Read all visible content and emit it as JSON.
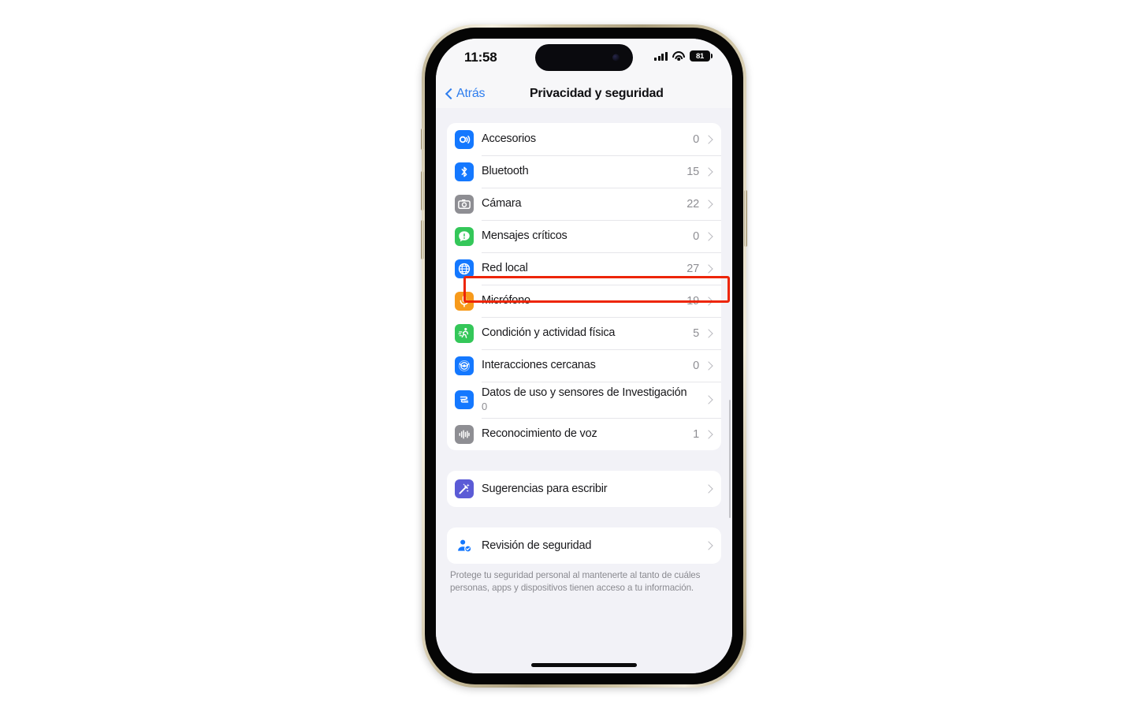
{
  "status_bar": {
    "time": "11:58",
    "cellular_icon": "cellular-bars-icon",
    "wifi_icon": "wifi-icon",
    "battery_level": "81"
  },
  "nav_bar": {
    "back_label": "Atrás",
    "title": "Privacidad y seguridad",
    "back_icon": "chevron-left-icon",
    "accent_color": "#2e7dee"
  },
  "highlight": {
    "color": "#ed2506",
    "target_row": "Red local"
  },
  "groups": [
    {
      "id": "permissions",
      "rows": [
        {
          "label": "Accesorios",
          "count": "0",
          "icon": "accessories-icon",
          "icon_color": "#1478ff"
        },
        {
          "label": "Bluetooth",
          "count": "15",
          "icon": "bluetooth-icon",
          "icon_color": "#1478ff"
        },
        {
          "label": "Cámara",
          "count": "22",
          "icon": "camera-icon",
          "icon_color": "#8e8e93"
        },
        {
          "label": "Mensajes críticos",
          "count": "0",
          "icon": "critical-messages-icon",
          "icon_color": "#34c759"
        },
        {
          "label": "Red local",
          "count": "27",
          "icon": "local-network-globe-icon",
          "icon_color": "#1478ff"
        },
        {
          "label": "Micrófono",
          "count": "19",
          "icon": "microphone-icon",
          "icon_color": "#f79a1b"
        },
        {
          "label": "Condición y actividad física",
          "count": "5",
          "icon": "fitness-running-icon",
          "icon_color": "#34c759"
        },
        {
          "label": "Interacciones cercanas",
          "count": "0",
          "icon": "nearby-interactions-icon",
          "icon_color": "#1478ff"
        },
        {
          "label": "Datos de uso y sensores de Investigación",
          "count": "0",
          "icon": "research-sensor-icon",
          "icon_color": "#1478ff"
        },
        {
          "label": "Reconocimiento de voz",
          "count": "1",
          "icon": "voice-waveform-icon",
          "icon_color": "#8e8e93"
        }
      ]
    },
    {
      "id": "typing-suggestions",
      "rows": [
        {
          "label": "Sugerencias para escribir",
          "count": "",
          "icon": "magic-wand-icon",
          "icon_color": "#5b5bd6"
        }
      ]
    },
    {
      "id": "safety-check",
      "rows": [
        {
          "label": "Revisión de seguridad",
          "count": "",
          "icon": "person-shield-icon",
          "icon_color": "#1478ff"
        }
      ],
      "footnote": "Protege tu seguridad personal al mantenerte al tanto de cuáles personas, apps y dispositivos tienen acceso a tu información."
    }
  ]
}
